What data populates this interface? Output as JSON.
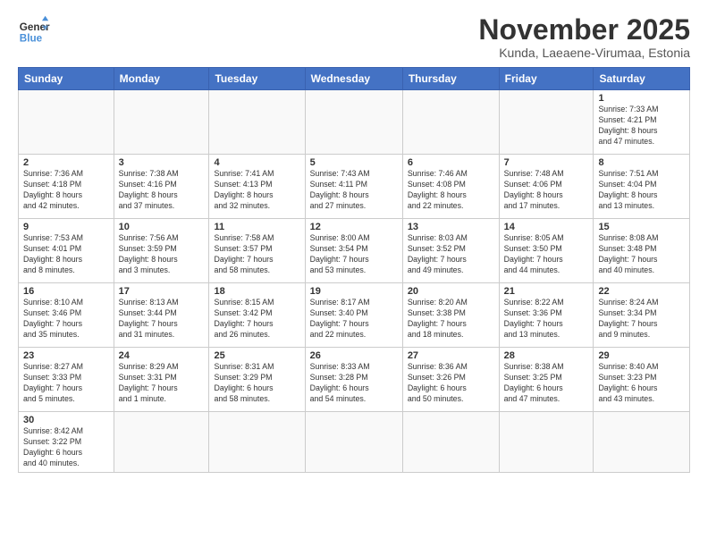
{
  "logo": {
    "text_general": "General",
    "text_blue": "Blue"
  },
  "header": {
    "title": "November 2025",
    "subtitle": "Kunda, Laeaene-Virumaa, Estonia"
  },
  "weekdays": [
    "Sunday",
    "Monday",
    "Tuesday",
    "Wednesday",
    "Thursday",
    "Friday",
    "Saturday"
  ],
  "weeks": [
    [
      {
        "day": "",
        "info": ""
      },
      {
        "day": "",
        "info": ""
      },
      {
        "day": "",
        "info": ""
      },
      {
        "day": "",
        "info": ""
      },
      {
        "day": "",
        "info": ""
      },
      {
        "day": "",
        "info": ""
      },
      {
        "day": "1",
        "info": "Sunrise: 7:33 AM\nSunset: 4:21 PM\nDaylight: 8 hours\nand 47 minutes."
      }
    ],
    [
      {
        "day": "2",
        "info": "Sunrise: 7:36 AM\nSunset: 4:18 PM\nDaylight: 8 hours\nand 42 minutes."
      },
      {
        "day": "3",
        "info": "Sunrise: 7:38 AM\nSunset: 4:16 PM\nDaylight: 8 hours\nand 37 minutes."
      },
      {
        "day": "4",
        "info": "Sunrise: 7:41 AM\nSunset: 4:13 PM\nDaylight: 8 hours\nand 32 minutes."
      },
      {
        "day": "5",
        "info": "Sunrise: 7:43 AM\nSunset: 4:11 PM\nDaylight: 8 hours\nand 27 minutes."
      },
      {
        "day": "6",
        "info": "Sunrise: 7:46 AM\nSunset: 4:08 PM\nDaylight: 8 hours\nand 22 minutes."
      },
      {
        "day": "7",
        "info": "Sunrise: 7:48 AM\nSunset: 4:06 PM\nDaylight: 8 hours\nand 17 minutes."
      },
      {
        "day": "8",
        "info": "Sunrise: 7:51 AM\nSunset: 4:04 PM\nDaylight: 8 hours\nand 13 minutes."
      }
    ],
    [
      {
        "day": "9",
        "info": "Sunrise: 7:53 AM\nSunset: 4:01 PM\nDaylight: 8 hours\nand 8 minutes."
      },
      {
        "day": "10",
        "info": "Sunrise: 7:56 AM\nSunset: 3:59 PM\nDaylight: 8 hours\nand 3 minutes."
      },
      {
        "day": "11",
        "info": "Sunrise: 7:58 AM\nSunset: 3:57 PM\nDaylight: 7 hours\nand 58 minutes."
      },
      {
        "day": "12",
        "info": "Sunrise: 8:00 AM\nSunset: 3:54 PM\nDaylight: 7 hours\nand 53 minutes."
      },
      {
        "day": "13",
        "info": "Sunrise: 8:03 AM\nSunset: 3:52 PM\nDaylight: 7 hours\nand 49 minutes."
      },
      {
        "day": "14",
        "info": "Sunrise: 8:05 AM\nSunset: 3:50 PM\nDaylight: 7 hours\nand 44 minutes."
      },
      {
        "day": "15",
        "info": "Sunrise: 8:08 AM\nSunset: 3:48 PM\nDaylight: 7 hours\nand 40 minutes."
      }
    ],
    [
      {
        "day": "16",
        "info": "Sunrise: 8:10 AM\nSunset: 3:46 PM\nDaylight: 7 hours\nand 35 minutes."
      },
      {
        "day": "17",
        "info": "Sunrise: 8:13 AM\nSunset: 3:44 PM\nDaylight: 7 hours\nand 31 minutes."
      },
      {
        "day": "18",
        "info": "Sunrise: 8:15 AM\nSunset: 3:42 PM\nDaylight: 7 hours\nand 26 minutes."
      },
      {
        "day": "19",
        "info": "Sunrise: 8:17 AM\nSunset: 3:40 PM\nDaylight: 7 hours\nand 22 minutes."
      },
      {
        "day": "20",
        "info": "Sunrise: 8:20 AM\nSunset: 3:38 PM\nDaylight: 7 hours\nand 18 minutes."
      },
      {
        "day": "21",
        "info": "Sunrise: 8:22 AM\nSunset: 3:36 PM\nDaylight: 7 hours\nand 13 minutes."
      },
      {
        "day": "22",
        "info": "Sunrise: 8:24 AM\nSunset: 3:34 PM\nDaylight: 7 hours\nand 9 minutes."
      }
    ],
    [
      {
        "day": "23",
        "info": "Sunrise: 8:27 AM\nSunset: 3:33 PM\nDaylight: 7 hours\nand 5 minutes."
      },
      {
        "day": "24",
        "info": "Sunrise: 8:29 AM\nSunset: 3:31 PM\nDaylight: 7 hours\nand 1 minute."
      },
      {
        "day": "25",
        "info": "Sunrise: 8:31 AM\nSunset: 3:29 PM\nDaylight: 6 hours\nand 58 minutes."
      },
      {
        "day": "26",
        "info": "Sunrise: 8:33 AM\nSunset: 3:28 PM\nDaylight: 6 hours\nand 54 minutes."
      },
      {
        "day": "27",
        "info": "Sunrise: 8:36 AM\nSunset: 3:26 PM\nDaylight: 6 hours\nand 50 minutes."
      },
      {
        "day": "28",
        "info": "Sunrise: 8:38 AM\nSunset: 3:25 PM\nDaylight: 6 hours\nand 47 minutes."
      },
      {
        "day": "29",
        "info": "Sunrise: 8:40 AM\nSunset: 3:23 PM\nDaylight: 6 hours\nand 43 minutes."
      }
    ],
    [
      {
        "day": "30",
        "info": "Sunrise: 8:42 AM\nSunset: 3:22 PM\nDaylight: 6 hours\nand 40 minutes."
      },
      {
        "day": "",
        "info": ""
      },
      {
        "day": "",
        "info": ""
      },
      {
        "day": "",
        "info": ""
      },
      {
        "day": "",
        "info": ""
      },
      {
        "day": "",
        "info": ""
      },
      {
        "day": "",
        "info": ""
      }
    ]
  ]
}
